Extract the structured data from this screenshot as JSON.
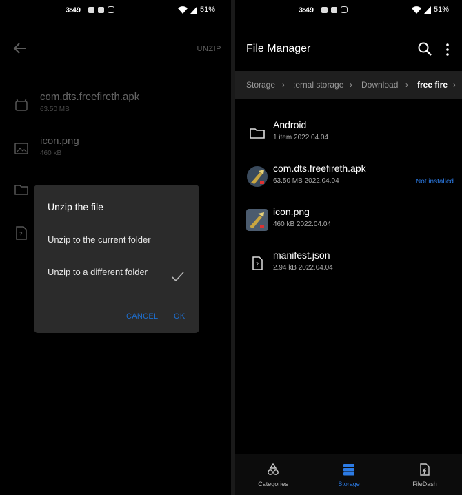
{
  "left": {
    "status": {
      "time": "3:49",
      "battery": "51%"
    },
    "toolbar": {
      "action": "UNZIP"
    },
    "files": [
      {
        "name": "com.dts.freefireth.apk",
        "size": "63.50 MB",
        "icon": "android-icon"
      },
      {
        "name": "icon.png",
        "size": "460 kB",
        "icon": "image-icon"
      }
    ],
    "dialog": {
      "title": "Unzip the file",
      "option_current": "Unzip to the current folder",
      "option_different": "Unzip to a different folder",
      "cancel": "CANCEL",
      "ok": "OK"
    }
  },
  "right": {
    "status": {
      "time": "3:49",
      "battery": "51%"
    },
    "title": "File Manager",
    "breadcrumbs": [
      "Storage",
      ":ernal storage",
      "Download",
      "free fire"
    ],
    "files": [
      {
        "name": "Android",
        "meta": "1 item   2022.04.04",
        "status": "",
        "icon": "folder-icon"
      },
      {
        "name": "com.dts.freefireth.apk",
        "meta": "63.50 MB   2022.04.04",
        "status": "Not installed",
        "icon": "apk-thumbnail"
      },
      {
        "name": "icon.png",
        "meta": "460 kB   2022.04.04",
        "status": "",
        "icon": "image-thumbnail"
      },
      {
        "name": "manifest.json",
        "meta": "2.94 kB   2022.04.04",
        "status": "",
        "icon": "file-icon"
      }
    ],
    "nav": [
      {
        "label": "Categories",
        "icon": "categories-icon",
        "active": false
      },
      {
        "label": "Storage",
        "icon": "storage-icon",
        "active": true
      },
      {
        "label": "FileDash",
        "icon": "filedash-icon",
        "active": false
      }
    ]
  },
  "colors": {
    "accent": "#2c7be5",
    "dialog_bg": "#2b2b2b",
    "background": "#000000"
  }
}
